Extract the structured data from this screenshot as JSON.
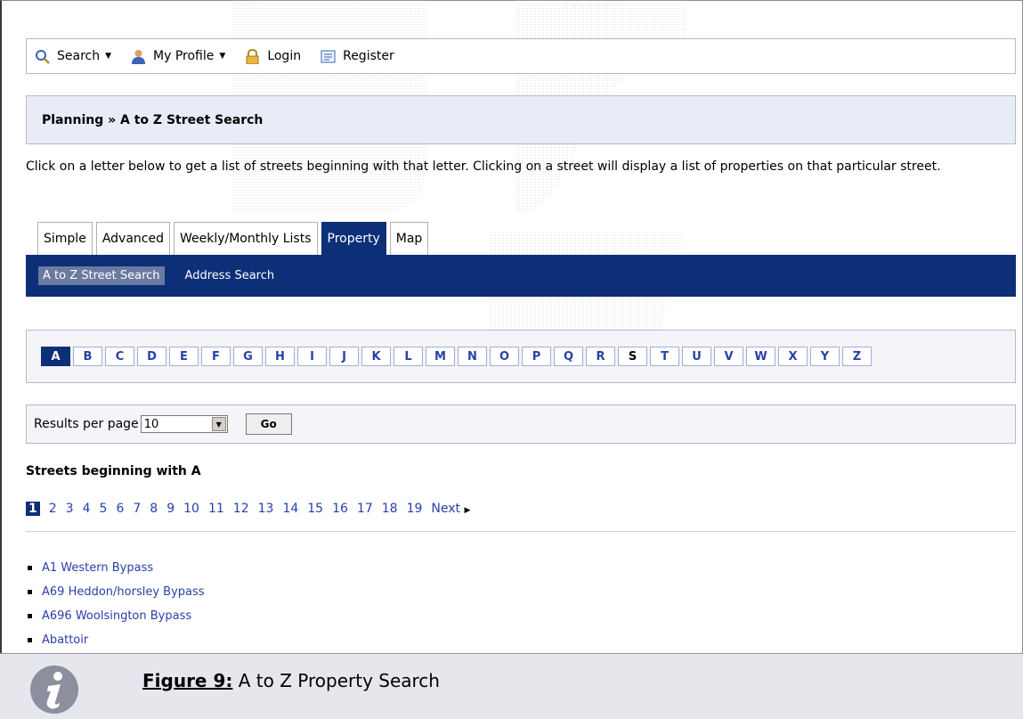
{
  "toolbar": {
    "search_label": "Search",
    "profile_label": "My Profile",
    "login_label": "Login",
    "register_label": "Register"
  },
  "breadcrumb": {
    "text": "Planning » A to Z Street Search"
  },
  "intro_text": "Click on a letter below to get a list of streets beginning with that letter. Clicking on a street will display a list of properties on that particular street.",
  "tabs": [
    {
      "label": "Simple"
    },
    {
      "label": "Advanced"
    },
    {
      "label": "Weekly/Monthly Lists"
    },
    {
      "label": "Property"
    },
    {
      "label": "Map"
    }
  ],
  "subnav": [
    {
      "label": "A to Z Street Search"
    },
    {
      "label": "Address Search"
    }
  ],
  "letters": [
    "A",
    "B",
    "C",
    "D",
    "E",
    "F",
    "G",
    "H",
    "I",
    "J",
    "K",
    "L",
    "M",
    "N",
    "O",
    "P",
    "Q",
    "R",
    "S",
    "T",
    "U",
    "V",
    "W",
    "X",
    "Y",
    "Z"
  ],
  "results": {
    "label": "Results per page",
    "selected": "10",
    "go_label": "Go"
  },
  "streets_title": "Streets beginning with A",
  "pager": {
    "pages": [
      "1",
      "2",
      "3",
      "4",
      "5",
      "6",
      "7",
      "8",
      "9",
      "10",
      "11",
      "12",
      "13",
      "14",
      "15",
      "16",
      "17",
      "18",
      "19"
    ],
    "next_label": "Next"
  },
  "streets": [
    "A1 Western Bypass",
    "A69 Heddon/horsley Bypass",
    "A696 Woolsington Bypass",
    "Abattoir"
  ],
  "caption": {
    "figure_label": "Figure 9:",
    "text": " A to Z Property Search"
  },
  "colors": {
    "nav_dark": "#0d2f77",
    "link": "#2a3fa8",
    "panel": "#e8ecf6"
  }
}
